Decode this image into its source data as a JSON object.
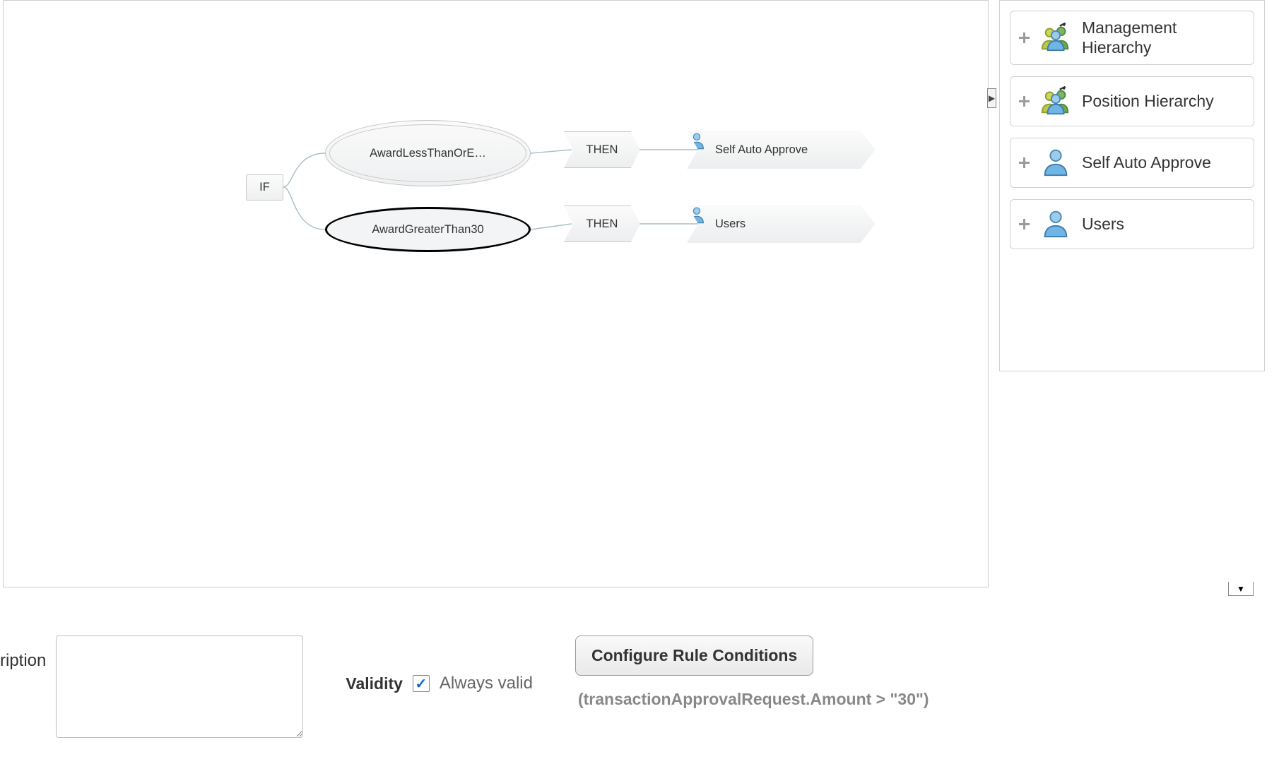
{
  "diagram": {
    "if_label": "IF",
    "branches": [
      {
        "condition_label": "AwardLessThanOrE…",
        "then_label": "THEN",
        "approver_label": "Self Auto Approve",
        "approver_icon": "user-icon-blue",
        "selected": false
      },
      {
        "condition_label": "AwardGreaterThan30",
        "then_label": "THEN",
        "approver_label": "Users",
        "approver_icon": "user-icon-blue",
        "selected": true
      }
    ]
  },
  "palette": {
    "items": [
      {
        "label": "Management Hierarchy",
        "icon": "group-icon"
      },
      {
        "label": "Position Hierarchy",
        "icon": "group-icon"
      },
      {
        "label": "Self Auto Approve",
        "icon": "user-icon-blue"
      },
      {
        "label": "Users",
        "icon": "user-icon-blue"
      }
    ]
  },
  "form": {
    "description_label": "ription",
    "description_value": "",
    "validity_label": "Validity",
    "validity_always_valid_checked": true,
    "validity_always_valid_text": "Always valid",
    "configure_button_label": "Configure Rule Conditions",
    "condition_expression": "(transactionApprovalRequest.Amount > \"30\")"
  },
  "icons": {
    "user-icon-blue": "single-person-blue",
    "group-icon": "three-person-group"
  }
}
